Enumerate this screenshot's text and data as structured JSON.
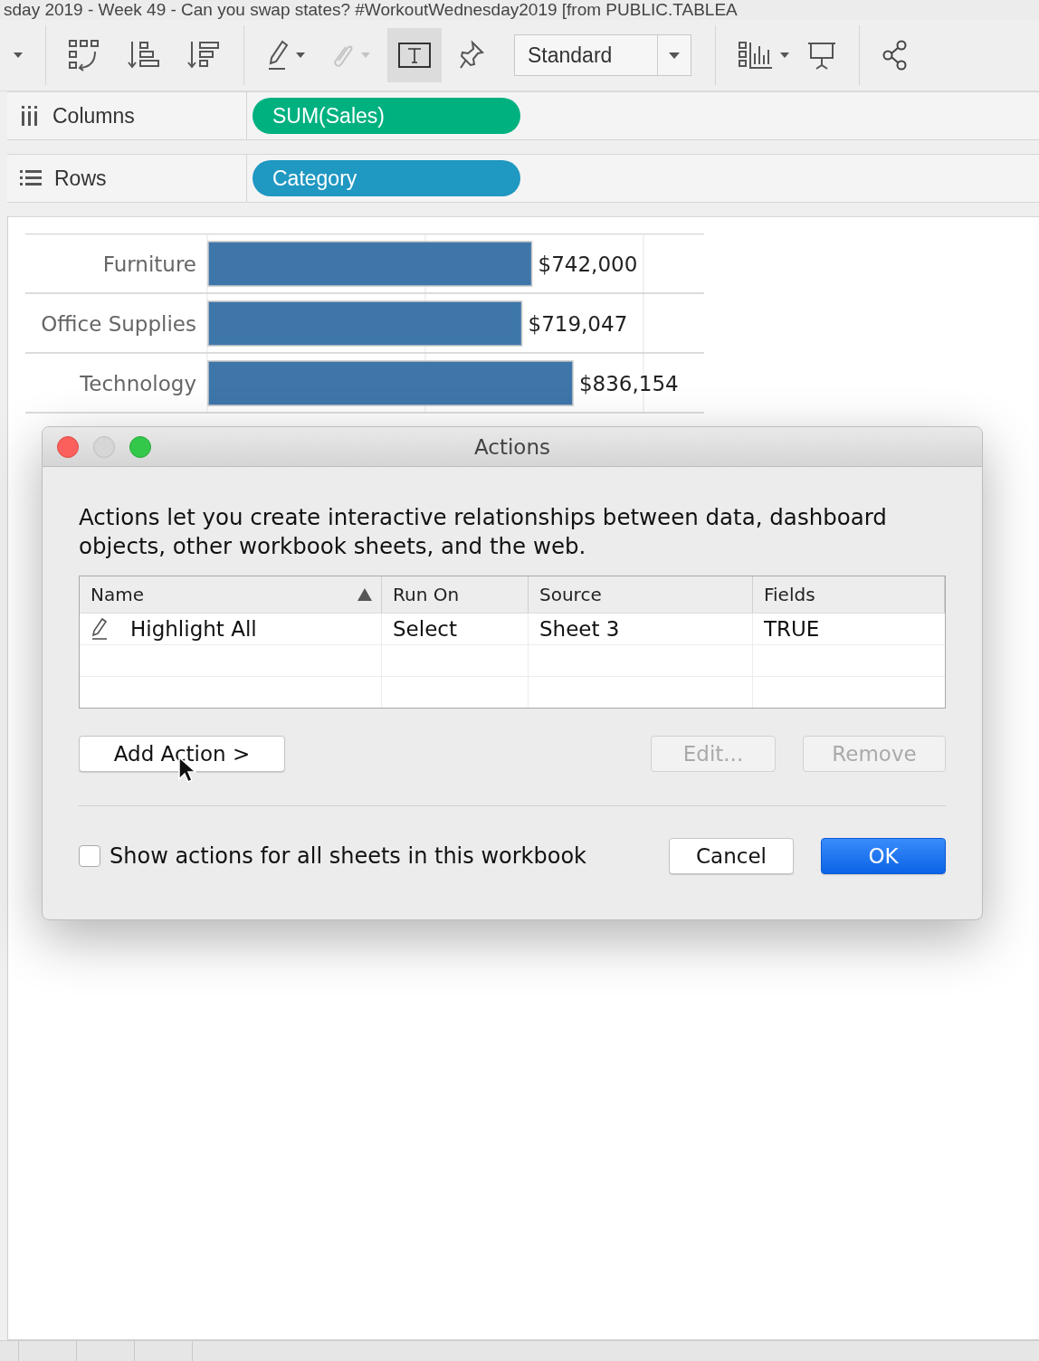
{
  "window": {
    "title": "sday 2019 - Week 49 - Can you swap states? #WorkoutWednesday2019 [from PUBLIC.TABLEA"
  },
  "toolbar": {
    "text_toggle": {
      "selected": true
    },
    "attach": {
      "disabled": true
    },
    "fit": "Standard"
  },
  "shelves": [
    {
      "kind": "columns",
      "label": "Columns",
      "pill": "SUM(Sales)",
      "color": "#00b180"
    },
    {
      "kind": "rows",
      "label": "Rows",
      "pill": "Category",
      "color": "#1f98c2"
    }
  ],
  "chart": {
    "chart_data": {
      "type": "bar",
      "orientation": "horizontal",
      "categories": [
        "Furniture",
        "Office Supplies",
        "Technology"
      ],
      "values": [
        742000,
        719047,
        836154
      ],
      "value_labels": [
        "$742,000",
        "$719,047",
        "$836,154"
      ],
      "ref_lines": [
        {
          "axis": "x",
          "value": 500000
        },
        {
          "axis": "x",
          "value": 1000000
        }
      ]
    }
  },
  "dialog": {
    "title": "Actions",
    "description": "Actions let you create interactive relationships between data, dashboard objects, other workbook sheets, and the web.",
    "columns": [
      {
        "label": "Name",
        "sorted": true
      },
      {
        "label": "Run On",
        "sorted": false
      },
      {
        "label": "Source",
        "sorted": false
      },
      {
        "label": "Fields",
        "sorted": false
      }
    ],
    "rows": [
      {
        "cells": [
          "Highlight All",
          "Select",
          "Sheet 3",
          "TRUE"
        ],
        "selected": false
      }
    ],
    "buttons": [
      {
        "label": "Add Action >",
        "disabled": false
      },
      {
        "label": "Edit...",
        "disabled": true
      },
      {
        "label": "Remove",
        "disabled": true
      }
    ],
    "show_all": {
      "label": "Show actions for all sheets in this workbook",
      "checked": false
    },
    "footer_buttons": [
      {
        "label": "Cancel",
        "default": false
      },
      {
        "label": "OK",
        "default": true
      }
    ]
  }
}
